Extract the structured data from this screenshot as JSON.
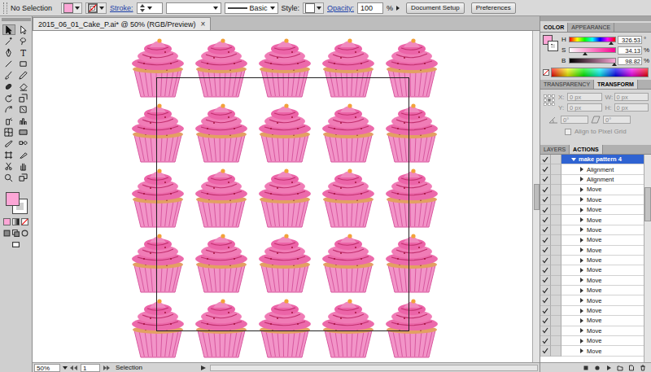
{
  "control_bar": {
    "selection": "No Selection",
    "fill_color": "#fca6d6",
    "stroke_label": "Stroke:",
    "stroke_profile": "Basic",
    "style_label": "Style:",
    "opacity_label": "Opacity:",
    "opacity": "100",
    "opacity_unit": "%",
    "buttons": [
      "Document Setup",
      "Preferences"
    ]
  },
  "document": {
    "tab": "2015_06_01_Cake_P.ai* @ 50% (RGB/Preview)",
    "close": "×"
  },
  "toolbar": {
    "type_tool": "T",
    "fill_color": "#fca6d6"
  },
  "color_panel": {
    "tabs": [
      {
        "label": "COLOR",
        "selected": true
      },
      {
        "label": "APPEARANCE",
        "selected": false
      }
    ],
    "channels": [
      {
        "name": "H",
        "value": "326.53",
        "unit": "°",
        "level": 0.907
      },
      {
        "name": "S",
        "value": "34.13",
        "unit": "%",
        "level": 0.341
      },
      {
        "name": "B",
        "value": "98.82",
        "unit": "%",
        "level": 0.988
      }
    ]
  },
  "transform_panel": {
    "tabs": [
      {
        "label": "TRANSPARENCY",
        "selected": false
      },
      {
        "label": "TRANSFORM",
        "selected": true
      }
    ],
    "disabled": true,
    "fields": [
      {
        "label": "X:",
        "value": "0 px"
      },
      {
        "label": "W:",
        "value": "0 px"
      },
      {
        "label": "Y:",
        "value": "0 px"
      },
      {
        "label": "H:",
        "value": "0 px"
      }
    ],
    "angle": "0°",
    "shear": "0°",
    "align_to_pixel_grid": {
      "label": "Align to Pixel Grid",
      "checked": false
    }
  },
  "actions_panel": {
    "tabs": [
      {
        "label": "LAYERS",
        "selected": false
      },
      {
        "label": "ACTIONS",
        "selected": true
      }
    ],
    "items": [
      {
        "label": "make pattern 4",
        "kind": "action",
        "expanded": true,
        "selected": true,
        "checked": true
      },
      {
        "label": "Alignment",
        "kind": "step",
        "expanded": false,
        "selected": false,
        "checked": true
      },
      {
        "label": "Alignment",
        "kind": "step",
        "expanded": false,
        "selected": false,
        "checked": true
      },
      {
        "label": "Move",
        "kind": "step",
        "expanded": false,
        "selected": false,
        "checked": true
      },
      {
        "label": "Move",
        "kind": "step",
        "expanded": false,
        "selected": false,
        "checked": true
      },
      {
        "label": "Move",
        "kind": "step",
        "expanded": false,
        "selected": false,
        "checked": true
      },
      {
        "label": "Move",
        "kind": "step",
        "expanded": false,
        "selected": false,
        "checked": true
      },
      {
        "label": "Move",
        "kind": "step",
        "expanded": false,
        "selected": false,
        "checked": true
      },
      {
        "label": "Move",
        "kind": "step",
        "expanded": false,
        "selected": false,
        "checked": true
      },
      {
        "label": "Move",
        "kind": "step",
        "expanded": false,
        "selected": false,
        "checked": true
      },
      {
        "label": "Move",
        "kind": "step",
        "expanded": false,
        "selected": false,
        "checked": true
      },
      {
        "label": "Move",
        "kind": "step",
        "expanded": false,
        "selected": false,
        "checked": true
      },
      {
        "label": "Move",
        "kind": "step",
        "expanded": false,
        "selected": false,
        "checked": true
      },
      {
        "label": "Move",
        "kind": "step",
        "expanded": false,
        "selected": false,
        "checked": true
      },
      {
        "label": "Move",
        "kind": "step",
        "expanded": false,
        "selected": false,
        "checked": true
      },
      {
        "label": "Move",
        "kind": "step",
        "expanded": false,
        "selected": false,
        "checked": true
      },
      {
        "label": "Move",
        "kind": "step",
        "expanded": false,
        "selected": false,
        "checked": true
      },
      {
        "label": "Move",
        "kind": "step",
        "expanded": false,
        "selected": false,
        "checked": true
      },
      {
        "label": "Move",
        "kind": "step",
        "expanded": false,
        "selected": false,
        "checked": true
      },
      {
        "label": "Move",
        "kind": "step",
        "expanded": false,
        "selected": false,
        "checked": true
      }
    ]
  },
  "status_bar": {
    "zoom": "50%",
    "artboard": "1",
    "tool": "Selection"
  }
}
